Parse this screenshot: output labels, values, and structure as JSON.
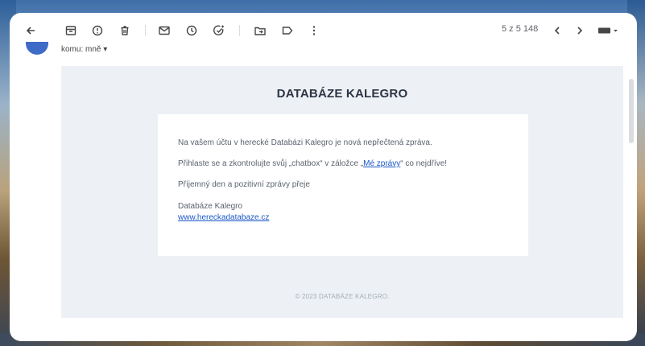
{
  "toolbar": {
    "pagination": "5 z 5 148"
  },
  "recipient": {
    "to_label": "komu: mně ▾"
  },
  "email": {
    "title": "DATABÁZE KALEGRO",
    "line1": "Na vašem účtu v herecké Databázi Kalegro je nová nepřečtená zpráva.",
    "line2_prefix": "Přihlaste se a zkontrolujte svůj „chatbox“ v záložce „",
    "line2_link": "Mé zprávy",
    "line2_suffix": "“ co nejdříve!",
    "line3": "Příjemný den a pozitivní zprávy přeje",
    "signature_name": "Databáze Kalegro",
    "signature_link": "www.hereckadatabaze.cz",
    "footer": "© 2023 DATABÁZE KALEGRO."
  }
}
